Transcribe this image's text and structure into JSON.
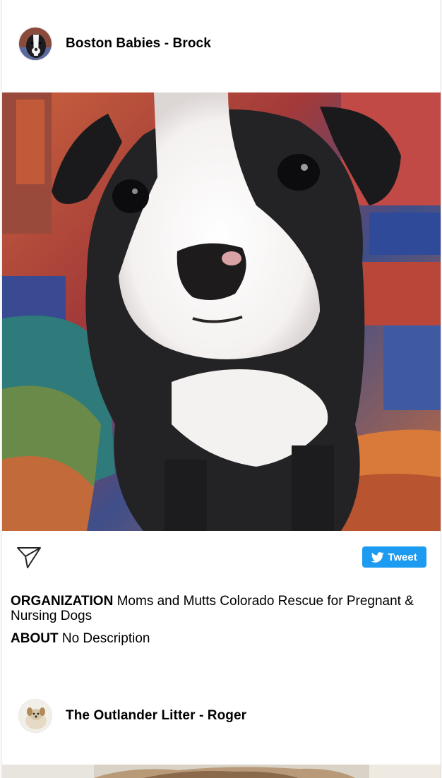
{
  "posts": [
    {
      "title": "Boston Babies - Brock",
      "avatar_icon": "puppy-avatar",
      "share_icon": "paper-plane-icon",
      "tweet_label": "Tweet",
      "org_label": "ORGANIZATION",
      "org_value": "Moms and Mutts Colorado Rescue for Pregnant & Nursing Dogs",
      "about_label": "ABOUT",
      "about_value": "No Description"
    },
    {
      "title": "The Outlander Litter - Roger",
      "avatar_icon": "puppy-avatar"
    }
  ],
  "colors": {
    "tweet_button": "#1d9bf0",
    "border": "#dbdbdb"
  }
}
